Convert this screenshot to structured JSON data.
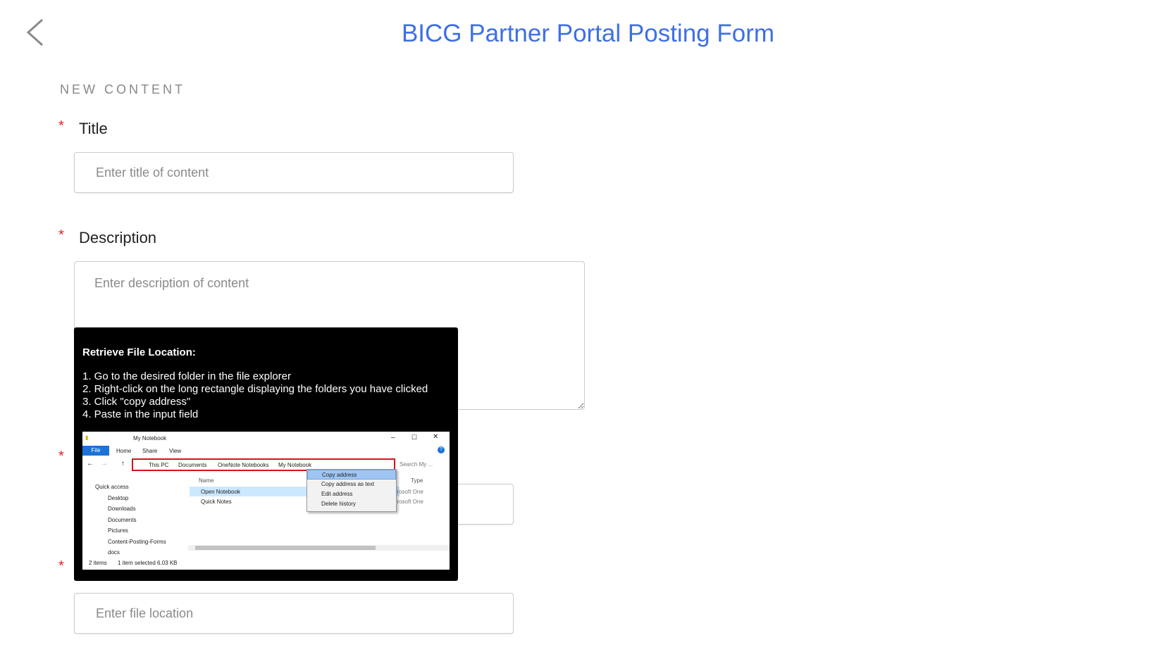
{
  "header": {
    "title": "BICG Partner Portal Posting Form",
    "back_icon": "chevron-left-icon"
  },
  "section": {
    "label": "NEW CONTENT"
  },
  "form": {
    "required_mark": "*",
    "title": {
      "label": "Title",
      "placeholder": "Enter title of content",
      "value": ""
    },
    "description": {
      "label": "Description",
      "placeholder": "Enter description of content",
      "value": ""
    },
    "third": {
      "placeholder": "",
      "value": ""
    },
    "file_location": {
      "placeholder": "Enter file location",
      "value": ""
    }
  },
  "tooltip": {
    "title": "Retrieve File Location:",
    "steps": [
      "1. Go to the desired folder in the file explorer",
      "2. Right-click on the long rectangle displaying the folders you have clicked",
      "3. Click \"copy address\"",
      "4. Paste in the input field"
    ],
    "screenshot": {
      "window_title": "My Notebook",
      "ribbon_tabs": [
        "File",
        "Home",
        "Share",
        "View"
      ],
      "breadcrumb": [
        "This PC",
        "Documents",
        "OneNote Notebooks",
        "My Notebook"
      ],
      "search_placeholder": "Search My ...",
      "context_menu": [
        "Copy address",
        "Copy address as text",
        "Edit address",
        "Delete history"
      ],
      "columns": [
        "Name",
        "Type"
      ],
      "nav_items": [
        "Quick access",
        "Desktop",
        "Downloads",
        "Documents",
        "Pictures",
        "Content-Posting-Forms",
        "docs"
      ],
      "files": [
        {
          "name": "Open Notebook",
          "type": "Microsoft One"
        },
        {
          "name": "Quick Notes",
          "type": "Microsoft One"
        }
      ],
      "status": {
        "items": "2 items",
        "selected": "1 item selected  6.03 KB"
      }
    }
  }
}
